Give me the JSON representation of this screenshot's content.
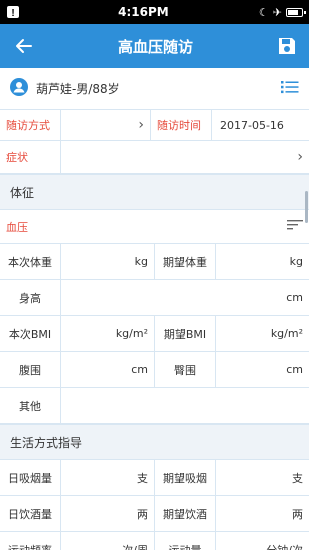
{
  "status_bar": {
    "time": "4:16PM"
  },
  "app_bar": {
    "title": "高血压随访"
  },
  "patient": {
    "name": "葫芦娃-男/88岁"
  },
  "visit": {
    "method_label": "随访方式",
    "time_label": "随访时间",
    "time_value": "2017-05-16",
    "symptom_label": "症状"
  },
  "vitals": {
    "section_title": "体征",
    "bp_label": "血压",
    "weight_label": "本次体重",
    "weight_unit": "kg",
    "target_weight_label": "期望体重",
    "target_weight_unit": "kg",
    "height_label": "身高",
    "height_unit": "cm",
    "bmi_label": "本次BMI",
    "bmi_unit": "kg/m²",
    "target_bmi_label": "期望BMI",
    "target_bmi_unit": "kg/m²",
    "waist_label": "腹围",
    "waist_unit": "cm",
    "hip_label": "臀围",
    "hip_unit": "cm",
    "other_label": "其他"
  },
  "lifestyle": {
    "section_title": "生活方式指导",
    "smoke_label": "日吸烟量",
    "smoke_unit": "支",
    "target_smoke_label": "期望吸烟",
    "target_smoke_unit": "支",
    "drink_label": "日饮酒量",
    "drink_unit": "两",
    "target_drink_label": "期望饮酒",
    "target_drink_unit": "两",
    "exercise_freq_label": "运动频率",
    "exercise_freq_unit": "次/周",
    "exercise_amount_label": "运动量",
    "exercise_amount_unit": "分钟/次"
  },
  "colors": {
    "primary": "#2e8fd9",
    "required_label": "#e64a3b",
    "section_bg": "#eef3f8"
  }
}
